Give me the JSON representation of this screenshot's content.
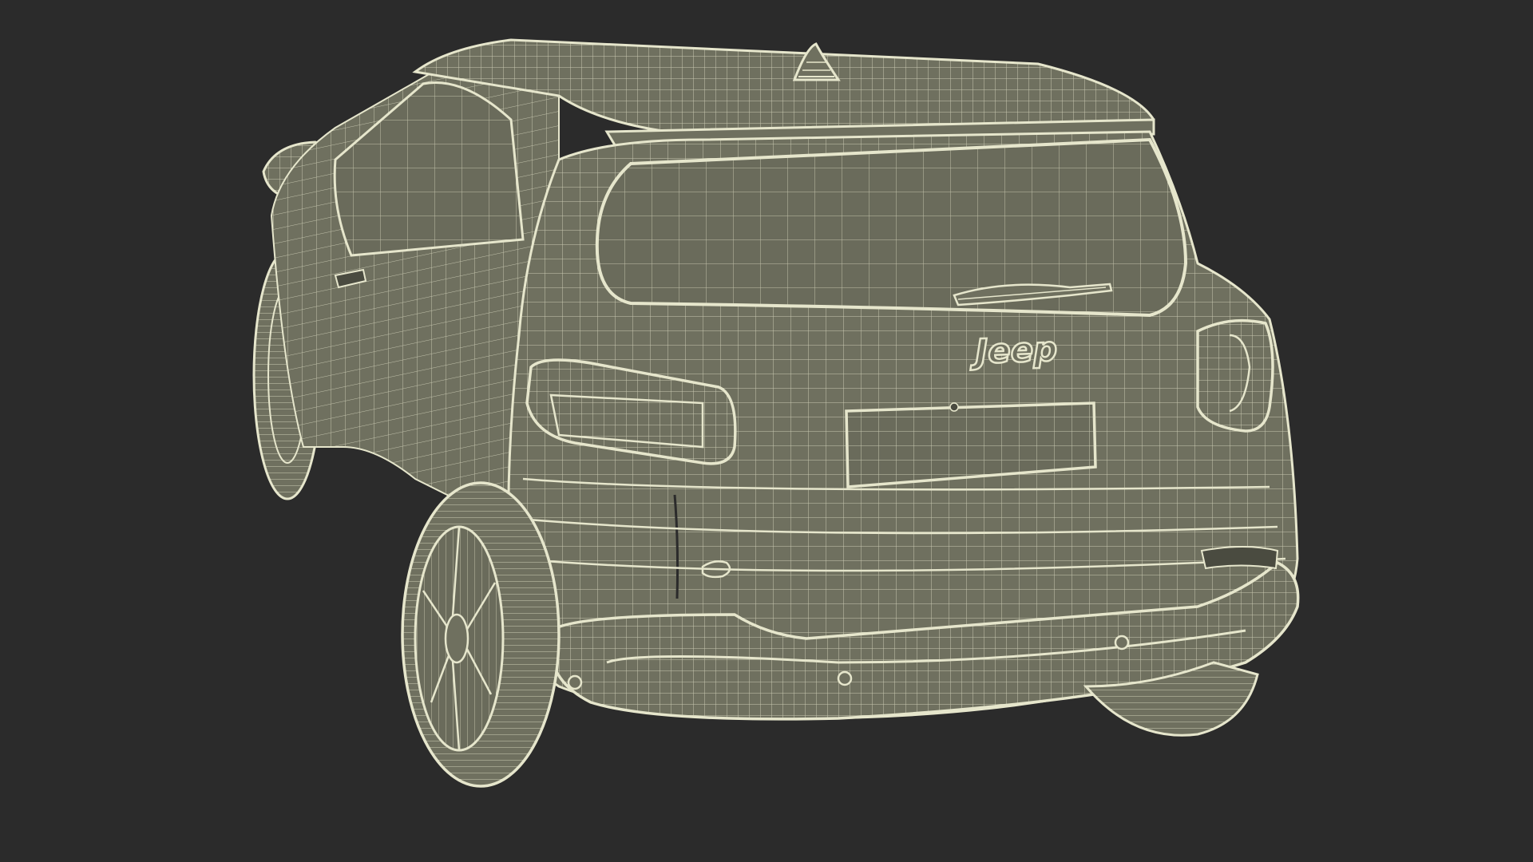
{
  "scene": {
    "background_color": "#2b2b2b",
    "body_color": "#6f705f",
    "wire_color": "#e6e6cc",
    "dark_detail_color": "#4a4b40"
  },
  "badges": {
    "rear_emblem": "Jeep"
  }
}
